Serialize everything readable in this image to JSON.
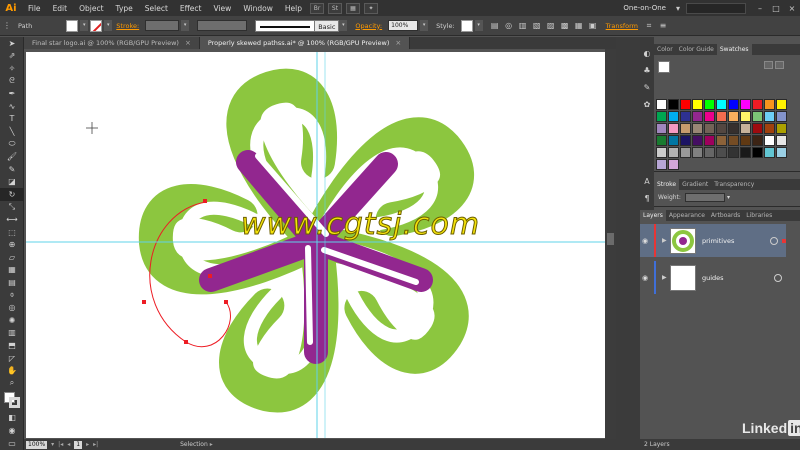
{
  "menubar": {
    "logo": "Ai",
    "items": [
      "File",
      "Edit",
      "Object",
      "Type",
      "Select",
      "Effect",
      "View",
      "Window",
      "Help"
    ],
    "bridge": "Br",
    "stock": "St",
    "workspace": "One-on-One"
  },
  "controlbar": {
    "selection_type": "Path",
    "stroke_label": "Stroke:",
    "stroke_style": "Basic",
    "opacity_label": "Opacity:",
    "opacity_value": "100%",
    "style_label": "Style:",
    "transform_label": "Transform"
  },
  "tabs": [
    {
      "label": "Final star logo.ai @ 100% (RGB/GPU Preview)",
      "active": false
    },
    {
      "label": "Properly skewed pathss.ai* @ 100% (RGB/GPU Preview)",
      "active": true
    }
  ],
  "watermark": "www.cgtsj.com",
  "statusbar": {
    "zoom": "100%",
    "artboard": "1",
    "tool": "Selection"
  },
  "panels": {
    "top_tabs": [
      "Color",
      "Color Guide",
      "Swatches"
    ],
    "stroke_tabs": [
      "Stroke",
      "Gradient",
      "Transparency"
    ],
    "weight_label": "Weight:",
    "layers_tabs": [
      "Layers",
      "Appearance",
      "Artboards",
      "Libraries"
    ],
    "layers": [
      {
        "name": "primitives",
        "color": "#e83535",
        "selected": true
      },
      {
        "name": "guides",
        "color": "#3f6fd8",
        "selected": false
      }
    ],
    "layers_count": "2 Layers"
  },
  "colors": {
    "green": "#8cc63f",
    "purple": "#92278f",
    "accent": "#ff9a00",
    "guide": "#5fd3e8"
  },
  "swatches": [
    "#ffffff",
    "#000000",
    "#ff0000",
    "#ffff00",
    "#00ff00",
    "#00ffff",
    "#0000ff",
    "#ff00ff",
    "#ed1c24",
    "#f7941d",
    "#fff200",
    "#00a651",
    "#00aeef",
    "#2e3192",
    "#92278f",
    "#ec008c",
    "#f26c4f",
    "#fbaf5d",
    "#fff568",
    "#7cc576",
    "#6dcff6",
    "#8393ca",
    "#a186be",
    "#f49ac2",
    "#c69c6d",
    "#998675",
    "#736357",
    "#534741",
    "#362f2d",
    "#c7b299",
    "#9e0b0f",
    "#a0410d",
    "#aba000",
    "#197b30",
    "#0076a3",
    "#1b1464",
    "#440e62",
    "#9e005d",
    "#8c6239",
    "#754c24",
    "#603913",
    "#3c2415",
    "#ffffff",
    "#e6e6e6",
    "#cccccc",
    "#b3b3b3",
    "#999999",
    "#808080",
    "#666666",
    "#4d4d4d",
    "#333333",
    "#1a1a1a",
    "#000000",
    "#62c6d3",
    "#9ad0e5",
    "#b7a6d6",
    "#d3a6d8"
  ],
  "branding": {
    "brand": "Linked",
    "in": "in"
  }
}
